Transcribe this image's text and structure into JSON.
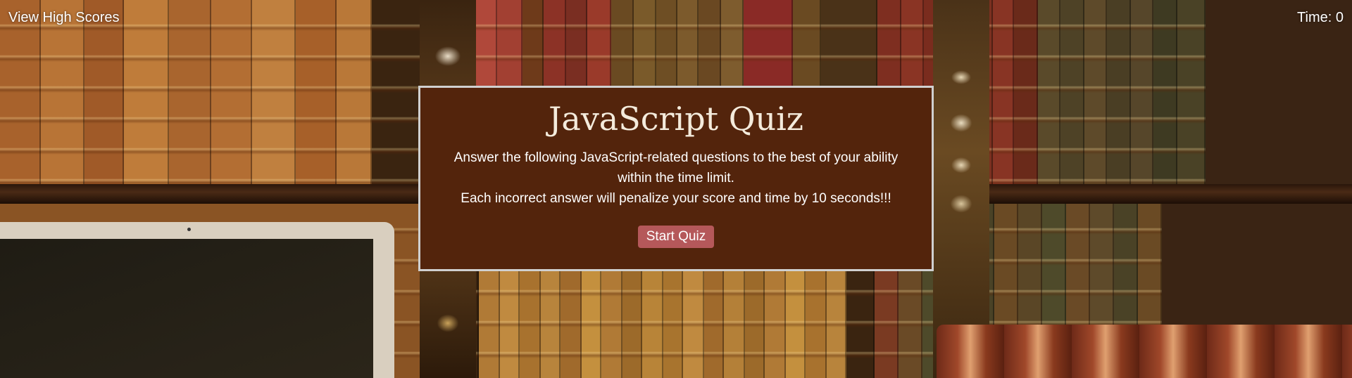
{
  "header": {
    "high_scores_link": "View High Scores",
    "timer_label": "Time:",
    "timer_value": "0"
  },
  "quiz": {
    "title": "JavaScript Quiz",
    "instructions_line1": "Answer the following JavaScript-related questions to the best of your ability within the time limit.",
    "instructions_line2": "Each incorrect answer will penalize your score and time by 10 seconds!!!",
    "start_button": "Start Quiz"
  },
  "colors": {
    "card_background": "#53240c",
    "card_border": "#d0d0d0",
    "button_background": "#b5585a",
    "text": "#ffffff"
  }
}
